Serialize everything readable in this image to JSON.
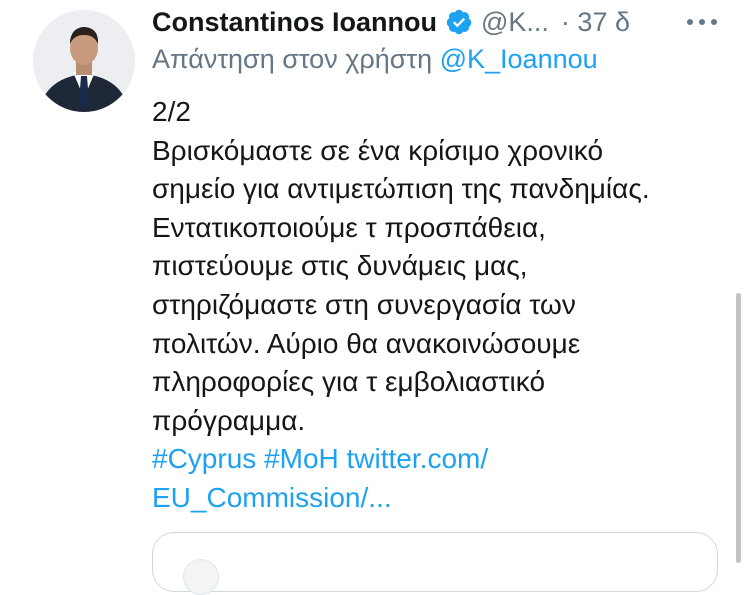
{
  "tweet": {
    "author_name": "Constantinos Ioannou",
    "handle": "@K...",
    "time_separator": "·",
    "time": "37 δ",
    "reply_prefix": "Απάντηση στον χρήστη",
    "reply_mention": "@K_Ioannou",
    "lines": [
      "2/2",
      "Βρισκόμαστε σε ένα κρίσιμο χρονικό",
      "σημείο για αντιμετώπιση της πανδημίας.",
      "Εντατικοποιούμε τ προσπάθεια,",
      "πιστεύουμε στις δυνάμεις μας,",
      "στηριζόμαστε στη συνεργασία των",
      "πολιτών. Αύριο θα ανακοινώσουμε",
      "πληροφορίες για τ εμβολιαστικό",
      "πρόγραμμα."
    ],
    "hashtag_1": "#Cyprus",
    "hashtag_2": "#MoH",
    "link_part_1": "twitter.com/",
    "link_part_2": "EU_Commission/..."
  },
  "colors": {
    "link": "#1da1f2",
    "muted": "#657786",
    "text": "#14171a"
  },
  "icons": {
    "verified": "verified-badge-icon",
    "more": "more-dots-icon"
  }
}
